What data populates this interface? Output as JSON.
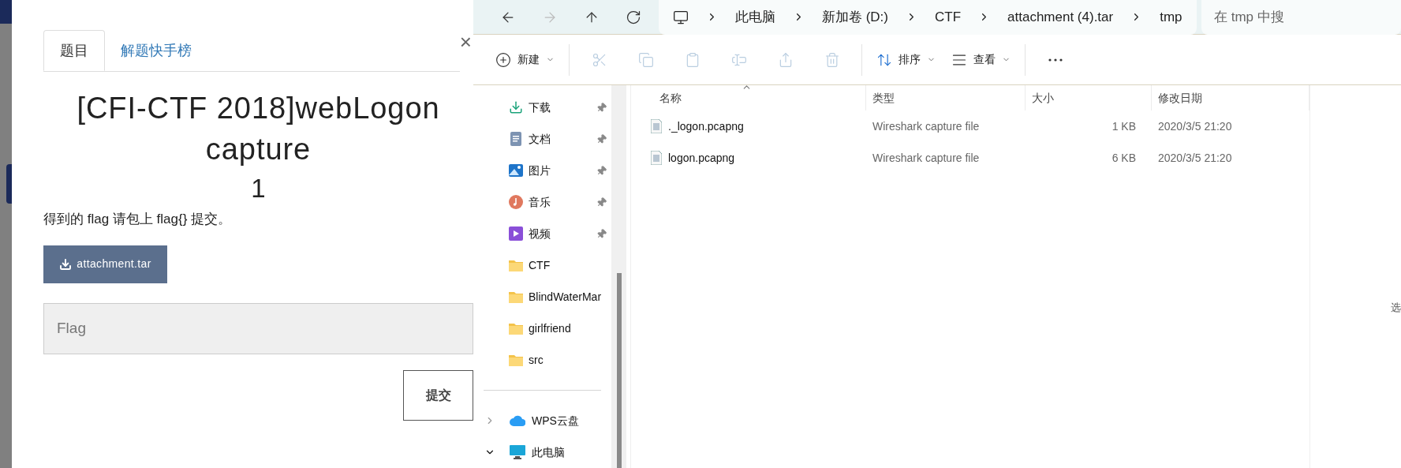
{
  "web_panel": {
    "tabs": [
      {
        "label": "题目",
        "selected": true
      },
      {
        "label": "解题快手榜",
        "selected": false
      }
    ],
    "close": "×",
    "title": "[CFI-CTF 2018]webLogon capture",
    "points": "1",
    "description": "得到的 flag 请包上 flag{} 提交。",
    "attachment": "attachment.tar",
    "flag_field": {
      "placeholder": "Flag"
    },
    "submit": "提交"
  },
  "explorer": {
    "nav": [
      {
        "kind": "back",
        "disabled": false
      },
      {
        "kind": "forward",
        "disabled": true
      },
      {
        "kind": "up",
        "disabled": false
      },
      {
        "kind": "refresh",
        "disabled": false
      }
    ],
    "breadcrumb": [
      "此电脑",
      "新加卷 (D:)",
      "CTF",
      "attachment (4).tar",
      "tmp"
    ],
    "search": {
      "placeholder": "在 tmp 中搜"
    },
    "toolbar": [
      {
        "kind": "new",
        "label": "新建",
        "disabled": false
      },
      {
        "kind": "cut",
        "disabled": true
      },
      {
        "kind": "copy",
        "disabled": true
      },
      {
        "kind": "paste",
        "disabled": true
      },
      {
        "kind": "rename",
        "disabled": true
      },
      {
        "kind": "share",
        "disabled": true
      },
      {
        "kind": "delete",
        "disabled": true
      },
      {
        "kind": "sort",
        "label": "排序",
        "disabled": false
      },
      {
        "kind": "view",
        "label": "查看",
        "disabled": false
      },
      {
        "kind": "more",
        "disabled": false
      }
    ],
    "sidebar": {
      "quick": [
        {
          "kind": "download",
          "label": "下载",
          "pinned": true
        },
        {
          "kind": "documents",
          "label": "文档",
          "pinned": true
        },
        {
          "kind": "pictures",
          "label": "图片",
          "pinned": true
        },
        {
          "kind": "music",
          "label": "音乐",
          "pinned": true
        },
        {
          "kind": "videos",
          "label": "视频",
          "pinned": true
        },
        {
          "kind": "folder",
          "label": "CTF",
          "pinned": false
        },
        {
          "kind": "folder",
          "label": "BlindWaterMar",
          "pinned": false
        },
        {
          "kind": "folder",
          "label": "girlfriend",
          "pinned": false
        },
        {
          "kind": "folder",
          "label": "src",
          "pinned": false
        }
      ],
      "locations": [
        {
          "kind": "cloud",
          "label": "WPS云盘",
          "expanded": false
        },
        {
          "kind": "pc",
          "label": "此电脑",
          "expanded": true
        }
      ]
    },
    "columns": [
      {
        "label": "名称",
        "sorted": true
      },
      {
        "label": "类型",
        "sorted": false
      },
      {
        "label": "大小",
        "sorted": false
      },
      {
        "label": "修改日期",
        "sorted": false
      }
    ],
    "files": [
      {
        "name": "._logon.pcapng",
        "type": "Wireshark capture file",
        "size": "1 KB",
        "modified": "2020/3/5 21:20"
      },
      {
        "name": "logon.pcapng",
        "type": "Wireshark capture file",
        "size": "6 KB",
        "modified": "2020/3/5 21:20"
      }
    ],
    "details_pane": {
      "text": "选"
    }
  }
}
